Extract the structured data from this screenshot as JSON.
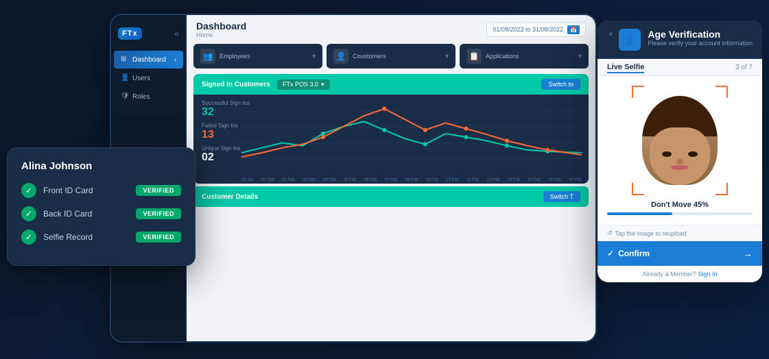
{
  "app": {
    "title": "FTx",
    "logo_text": "FTx"
  },
  "sidebar": {
    "collapse_icon": "«",
    "items": [
      {
        "label": "Dashboard",
        "active": true,
        "icon": "grid"
      },
      {
        "label": "Users",
        "active": false,
        "icon": "users"
      },
      {
        "label": "Roles",
        "active": false,
        "icon": "shield"
      }
    ]
  },
  "dashboard": {
    "title": "Dashboard",
    "breadcrumb": "Home",
    "date_range": "01/08/2022 to 31/08/2022",
    "stats": [
      {
        "label": "Employees",
        "icon": "👥"
      },
      {
        "label": "Coustomers",
        "icon": "👤"
      },
      {
        "label": "Applications",
        "icon": "📋"
      }
    ],
    "chart": {
      "title": "Signed In Customers",
      "pos_label": "FTx POS 3.0",
      "switch_label": "Switch to",
      "successful_label": "Successful Sign Ins",
      "successful_value": "32",
      "failed_label": "Failed Sign Ins",
      "failed_value": "13",
      "unique_label": "Unique Sign Ins",
      "unique_value": "02",
      "x_axis": [
        "21 Jan",
        "01 Feb",
        "02 Feb",
        "03 Feb",
        "04 Feb",
        "05 Feb",
        "06 Feb",
        "07 Feb",
        "08 Feb",
        "09 Feb",
        "10 Feb",
        "11 Feb",
        "12 Feb",
        "13 Feb",
        "14 Feb",
        "15 Feb",
        "16 Feb"
      ]
    },
    "customer_details": {
      "title": "Customer Details",
      "switch_label": "Switch T"
    }
  },
  "verification_card": {
    "name": "Alina Johnson",
    "items": [
      {
        "label": "Front ID Card",
        "status": "VERIFIED"
      },
      {
        "label": "Back ID Card",
        "status": "VERIFIED"
      },
      {
        "label": "Selfie Record",
        "status": "VERIFIED"
      }
    ]
  },
  "age_panel": {
    "back_icon": "‹",
    "title": "Age Verification",
    "subtitle": "Please verify your account information",
    "section_title": "Live Selfie",
    "count": "3 of 7",
    "dont_move": "Don't Move 45%",
    "progress_pct": 45,
    "tap_reload": "Tap the image to reupload",
    "confirm_label": "Confirm",
    "member_text": "Already a Member?",
    "signin_label": "Sign In"
  }
}
